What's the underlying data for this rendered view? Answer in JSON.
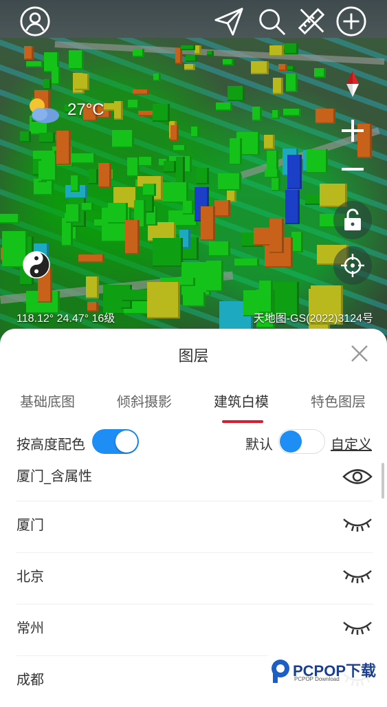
{
  "map": {
    "weather": {
      "temperature": "27°C",
      "icon": "partly-cloudy-icon"
    },
    "coordinates": "118.12°  24.47°  16级",
    "attribution": "天地图-GS(2022)3124号",
    "toolbar": {
      "icons": [
        "user-icon",
        "navigate-icon",
        "search-icon",
        "measure-icon",
        "add-icon"
      ]
    },
    "controls": [
      "compass-icon",
      "zoom-in-icon",
      "zoom-out-icon",
      "lock-icon",
      "locate-icon",
      "yin-yang-icon"
    ]
  },
  "panel": {
    "title": "图层",
    "tabs": [
      {
        "label": "基础底图",
        "active": false
      },
      {
        "label": "倾斜摄影",
        "active": false
      },
      {
        "label": "建筑白模",
        "active": true
      },
      {
        "label": "特色图层",
        "active": false
      }
    ],
    "color_by_height": {
      "label": "按高度配色",
      "on": true
    },
    "default_option": {
      "label": "默认",
      "on": false
    },
    "custom_link": "自定义",
    "layers": [
      {
        "label": "厦门_含属性",
        "visible": true
      },
      {
        "label": "厦门",
        "visible": false
      },
      {
        "label": "北京",
        "visible": false
      },
      {
        "label": "常州",
        "visible": false
      },
      {
        "label": "成都",
        "visible": false
      }
    ]
  },
  "watermark": {
    "main": "PCPOP下载",
    "sub": "PCPOP Download"
  },
  "colors": {
    "accent": "#1e8ef5",
    "tab_underline": "#e0192e"
  }
}
